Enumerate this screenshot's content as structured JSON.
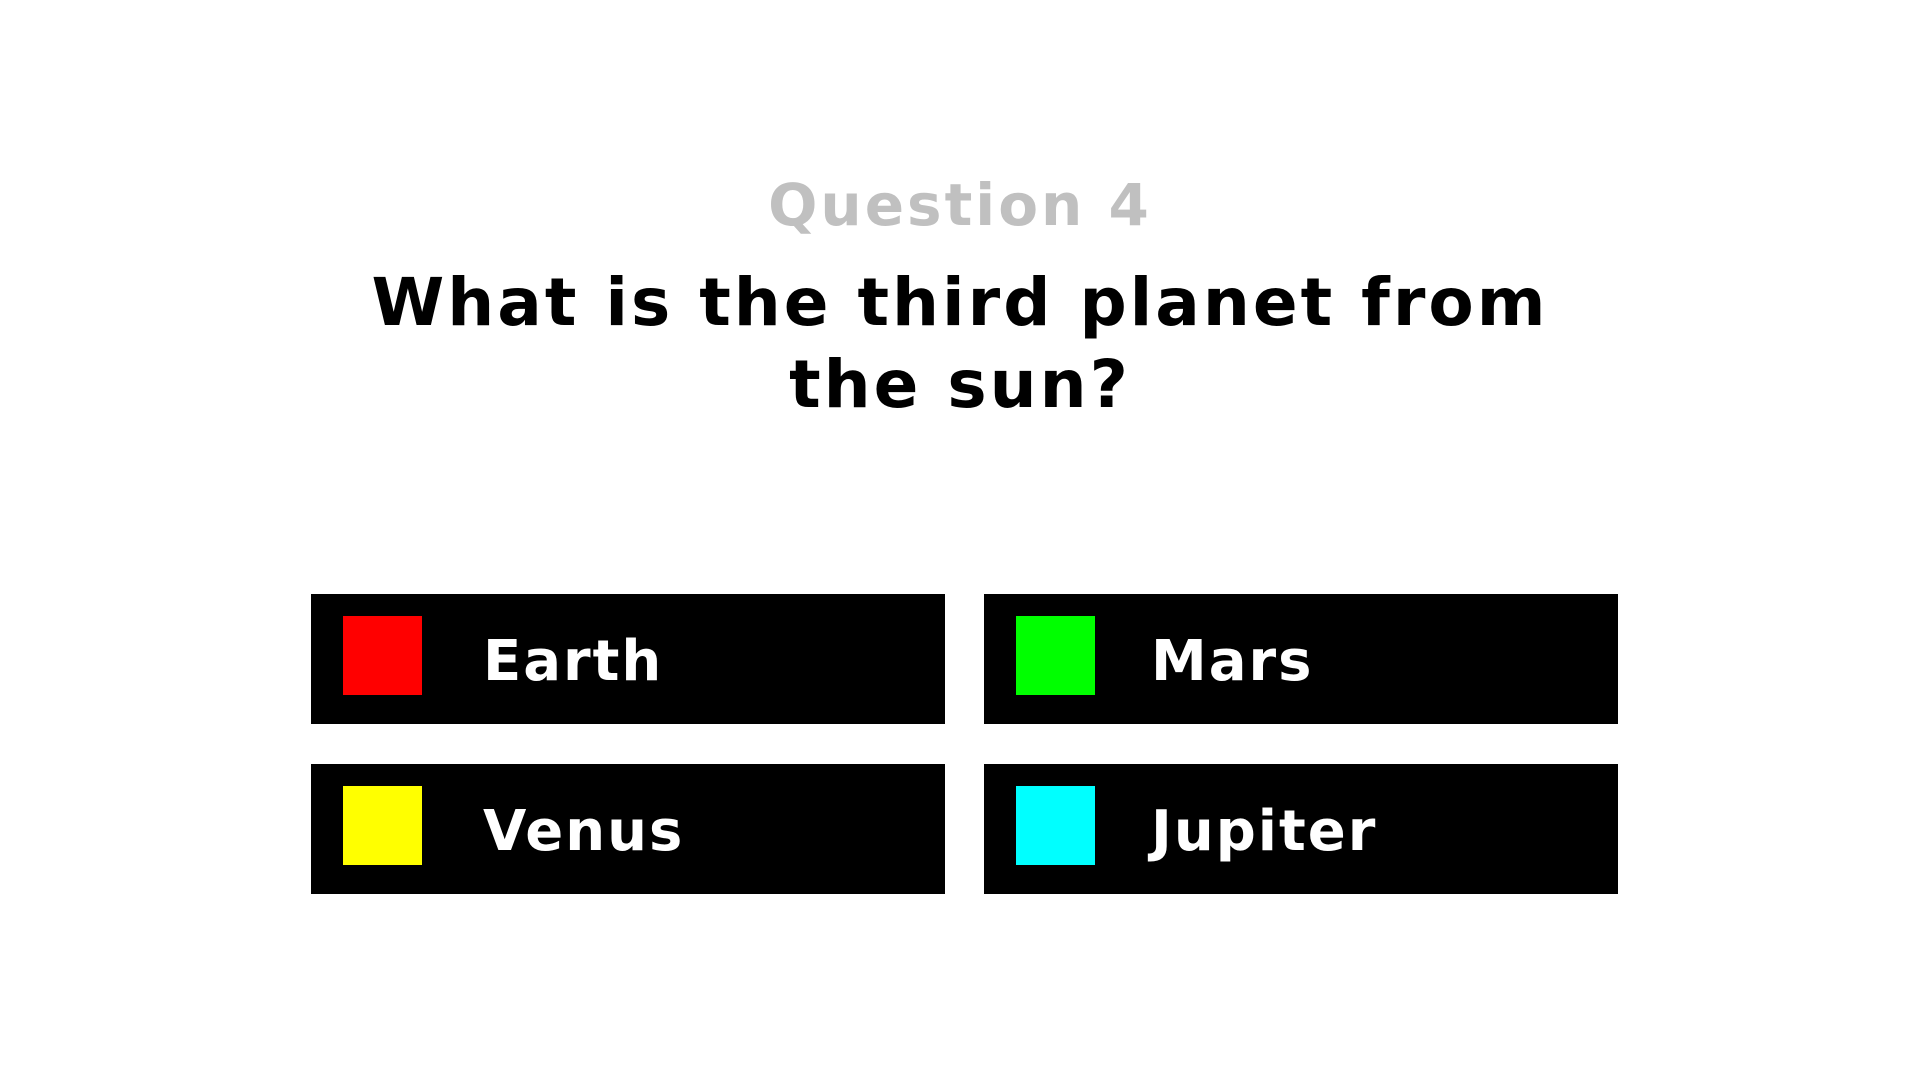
{
  "quiz": {
    "question_number": "Question 4",
    "question_text": "What is the third planet from the sun?",
    "answers": [
      {
        "label": "Earth",
        "color": "#ff0000"
      },
      {
        "label": "Mars",
        "color": "#00ff00"
      },
      {
        "label": "Venus",
        "color": "#ffff00"
      },
      {
        "label": "Jupiter",
        "color": "#00ffff"
      }
    ]
  }
}
